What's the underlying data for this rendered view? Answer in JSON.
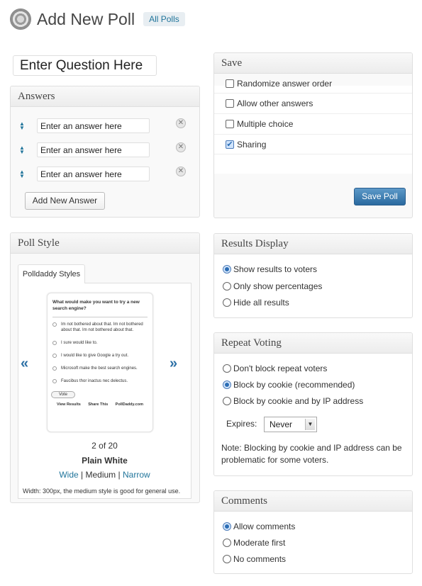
{
  "header": {
    "title": "Add New Poll",
    "all_polls": "All Polls"
  },
  "question": {
    "value": "Enter Question Here"
  },
  "answers": {
    "title": "Answers",
    "items": [
      {
        "value": "Enter an answer here"
      },
      {
        "value": "Enter an answer here"
      },
      {
        "value": "Enter an answer here"
      }
    ],
    "add_button": "Add New Answer"
  },
  "save": {
    "title": "Save",
    "options": [
      {
        "label": "Randomize answer order",
        "checked": false
      },
      {
        "label": "Allow other answers",
        "checked": false
      },
      {
        "label": "Multiple choice",
        "checked": false
      },
      {
        "label": "Sharing",
        "checked": true
      }
    ],
    "save_button": "Save Poll"
  },
  "poll_style": {
    "title": "Poll Style",
    "tab": "Polldaddy Styles",
    "preview": {
      "question": "What would make you want to try a new search engine?",
      "answers": [
        "Im not bothered about that. Im not bothered about that. Im not bothered about that.",
        "I sure would like to.",
        "I would like to give Google a try out.",
        "Microsoft make the best search engines.",
        "Faucibus thor inactus nec delectus."
      ],
      "vote": "Vote",
      "links": [
        "View Results",
        "Share This",
        "PollDaddy.com"
      ]
    },
    "counter": "2 of 20",
    "style_name": "Plain White",
    "sizes": {
      "wide": "Wide",
      "medium": "Medium",
      "narrow": "Narrow",
      "separator": "|"
    },
    "description": "Width: 300px, the medium style is good for general use."
  },
  "results_display": {
    "title": "Results Display",
    "options": [
      {
        "label": "Show results to voters",
        "checked": true
      },
      {
        "label": "Only show percentages",
        "checked": false
      },
      {
        "label": "Hide all results",
        "checked": false
      }
    ]
  },
  "repeat_voting": {
    "title": "Repeat Voting",
    "options": [
      {
        "label": "Don't block repeat voters",
        "checked": false
      },
      {
        "label": "Block by cookie (recommended)",
        "checked": true
      },
      {
        "label": "Block by cookie and by IP address",
        "checked": false
      }
    ],
    "expires_label": "Expires:",
    "expires_value": "Never",
    "note": "Note: Blocking by cookie and IP address can be problematic for some voters."
  },
  "comments": {
    "title": "Comments",
    "options": [
      {
        "label": "Allow comments",
        "checked": true
      },
      {
        "label": "Moderate first",
        "checked": false
      },
      {
        "label": "No comments",
        "checked": false
      }
    ]
  }
}
